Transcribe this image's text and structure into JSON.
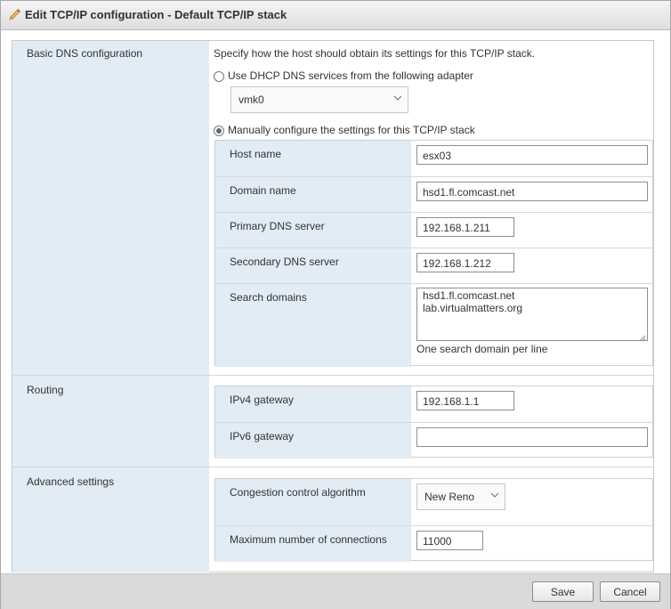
{
  "dialog": {
    "title": "Edit TCP/IP configuration - Default TCP/IP stack",
    "title_icon": "pencil-icon"
  },
  "dns": {
    "section_label": "Basic DNS configuration",
    "instruction": "Specify how the host should obtain its settings for this TCP/IP stack.",
    "dhcp_option_label": "Use DHCP DNS services from the following adapter",
    "dhcp_selected": false,
    "adapter_value": "vmk0",
    "manual_option_label": "Manually configure the settings for this TCP/IP stack",
    "manual_selected": true,
    "host_name_label": "Host name",
    "host_name_value": "esx03",
    "domain_name_label": "Domain name",
    "domain_name_value": "hsd1.fl.comcast.net",
    "primary_dns_label": "Primary DNS server",
    "primary_dns_value": "192.168.1.211",
    "secondary_dns_label": "Secondary DNS server",
    "secondary_dns_value": "192.168.1.212",
    "search_domains_label": "Search domains",
    "search_domains": [
      "hsd1.fl.comcast.net",
      "lab.virtualmatters.org"
    ],
    "search_domains_hint": "One search domain per line"
  },
  "routing": {
    "section_label": "Routing",
    "ipv4_label": "IPv4 gateway",
    "ipv4_value": "192.168.1.1",
    "ipv6_label": "IPv6 gateway",
    "ipv6_value": ""
  },
  "advanced": {
    "section_label": "Advanced settings",
    "congestion_label": "Congestion control algorithm",
    "congestion_value": "New Reno",
    "max_conn_label": "Maximum number of connections",
    "max_conn_value": "11000"
  },
  "footer": {
    "save_label": "Save",
    "cancel_label": "Cancel"
  }
}
